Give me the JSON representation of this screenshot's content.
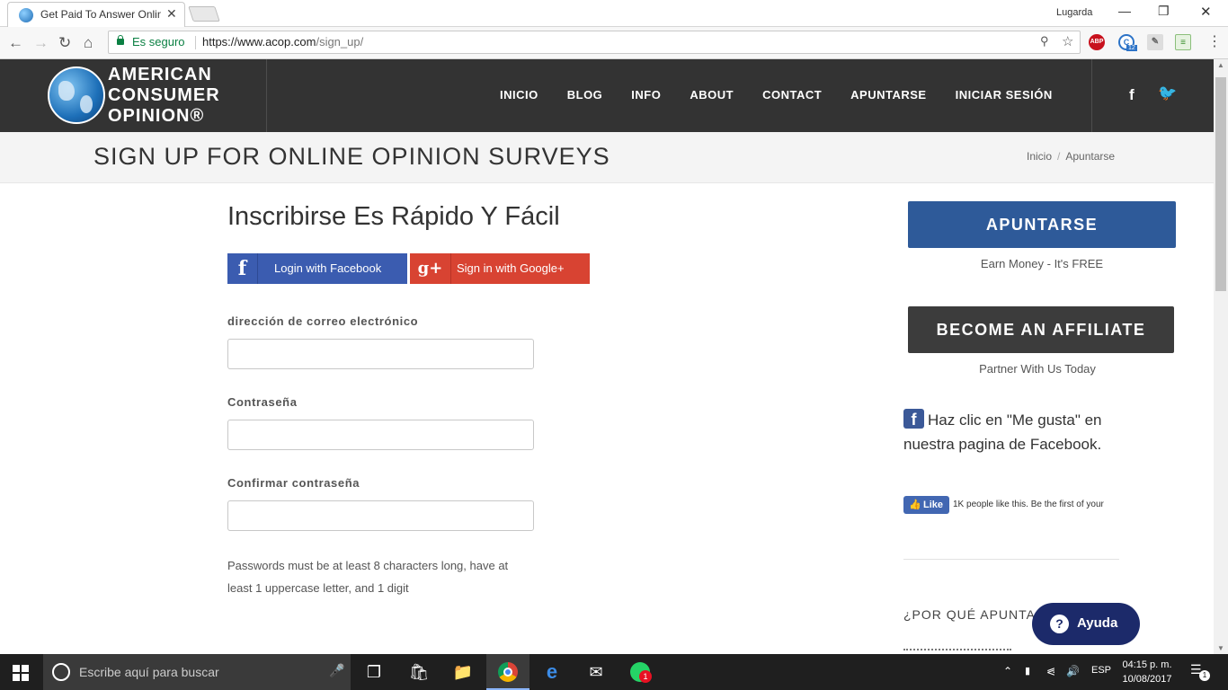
{
  "browser": {
    "tab_title": "Get Paid To Answer Online",
    "tab_close": "✕",
    "user": "Lugarda",
    "window_controls": {
      "minimize": "—",
      "restore": "❐",
      "close": "✕"
    },
    "secure_label": "Es seguro",
    "url_base": "https://www.acop.com",
    "url_path": "/sign_up/",
    "extensions": {
      "abp": "ABP",
      "badge": "12"
    }
  },
  "site": {
    "logo_lines": [
      "AMERICAN",
      "CONSUMER",
      "OPINION®"
    ],
    "nav": [
      "INICIO",
      "BLOG",
      "INFO",
      "ABOUT",
      "CONTACT",
      "APUNTARSE",
      "INICIAR SESIÓN"
    ],
    "social": {
      "facebook": "f",
      "twitter": "🐦"
    }
  },
  "page": {
    "title": "SIGN UP FOR ONLINE OPINION SURVEYS",
    "breadcrumb": {
      "home": "Inicio",
      "separator": "/",
      "current": "Apuntarse"
    }
  },
  "form": {
    "heading": "Inscribirse Es Rápido Y Fácil",
    "facebook_button": "Login with Facebook",
    "facebook_icon": "f",
    "google_button": "Sign in with Google+",
    "google_icon": "g+",
    "email_label": "dirección de correo electrónico",
    "email_value": "",
    "password_label": "Contraseña",
    "password_value": "",
    "confirm_label": "Confirmar contraseña",
    "confirm_value": "",
    "password_note": "Passwords must be at least 8 characters long, have at least 1 uppercase letter, and 1 digit"
  },
  "sidebar": {
    "apuntarse_button": "APUNTARSE",
    "earn_text": "Earn Money - It's FREE",
    "affiliate_button": "BECOME AN AFFILIATE",
    "partner_text": "Partner With Us Today",
    "like_heading": "Haz clic en \"Me gusta\" en nuestra pagina de Facebook.",
    "like_button": "Like",
    "like_count": "1K people like this. Be the first of your",
    "why_heading": "¿POR QUÉ APUNTA",
    "help_button": "Ayuda"
  },
  "taskbar": {
    "search_placeholder": "Escribe aquí para buscar",
    "whatsapp_badge": "1",
    "language": "ESP",
    "time": "04:15 p. m.",
    "date": "10/08/2017",
    "notifications": "1"
  }
}
